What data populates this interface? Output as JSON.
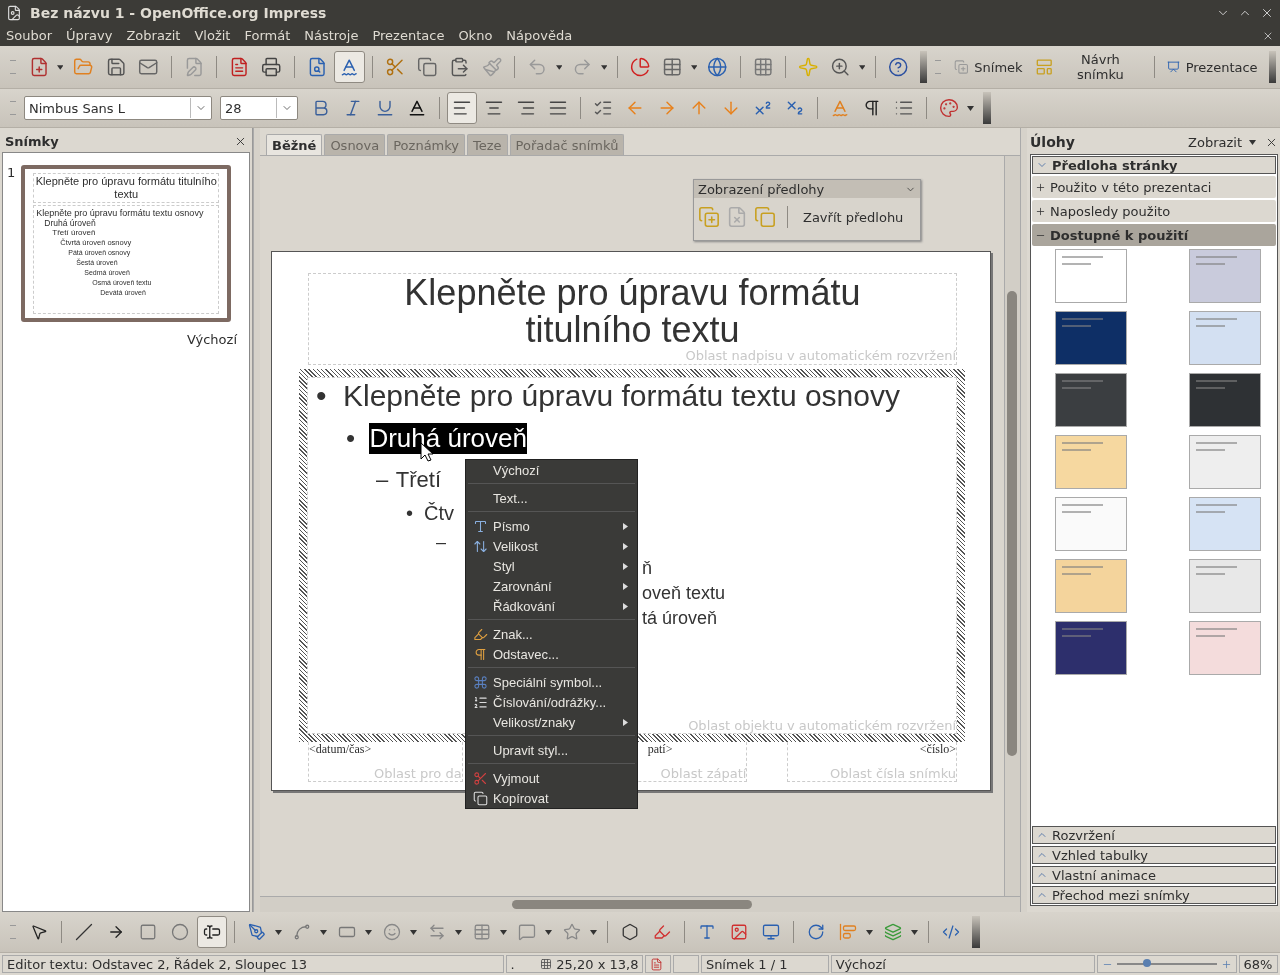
{
  "window": {
    "title": "Bez názvu 1 - OpenOffice.org Impress"
  },
  "menu": [
    "Soubor",
    "Úpravy",
    "Zobrazit",
    "Vložit",
    "Formát",
    "Nástroje",
    "Prezentace",
    "Okno",
    "Nápověda"
  ],
  "standard_toolbar": [
    {
      "pressed": false
    },
    {
      "pressed": false
    },
    {
      "pressed": false
    },
    {
      "pressed": false
    },
    {
      "pressed": false
    },
    {
      "pressed": false
    },
    {
      "pressed": false
    },
    {
      "pressed": false
    },
    {
      "pressed": true
    },
    {
      "pressed": false
    },
    {
      "pressed": false
    },
    {
      "pressed": false
    },
    {
      "pressed": false
    },
    {
      "pressed": false
    },
    {
      "pressed": false
    },
    {
      "pressed": false
    },
    {
      "pressed": false
    },
    {
      "pressed": false
    },
    {
      "pressed": false
    },
    {
      "pressed": false
    },
    {
      "pressed": false
    },
    {
      "pressed": false
    }
  ],
  "presentation_toolbar": [
    {
      "label": "Snímek"
    },
    {
      "label": "Návrh snímku"
    },
    {
      "label": "Prezentace"
    }
  ],
  "formatting_toolbar": {
    "font": "Nimbus Sans L",
    "size": "28",
    "buttons": [
      {
        "pressed": false
      },
      {
        "pressed": false
      },
      {
        "pressed": false
      },
      {
        "pressed": false
      },
      {
        "pressed": true
      },
      {
        "pressed": false
      },
      {
        "pressed": false
      },
      {
        "pressed": false
      },
      {
        "pressed": false
      },
      {
        "pressed": false
      },
      {
        "pressed": false
      },
      {
        "pressed": false
      },
      {
        "pressed": false
      },
      {
        "pressed": false
      },
      {
        "pressed": false
      },
      {
        "pressed": false
      },
      {
        "pressed": false
      },
      {
        "pressed": false
      },
      {
        "pressed": false
      }
    ]
  },
  "slides_panel": {
    "title": "Snímky",
    "slides": [
      {
        "number": "1",
        "layout": "Výchozí",
        "selected": true,
        "title": "Klepněte pro úpravu formátu titulního textu",
        "outline": [
          "Klepněte pro úpravu formátu textu osnovy",
          "Druhá úroveň",
          "Třetí úroveň",
          "Čtvrtá úroveň osnovy",
          "Pátá úroveň osnovy",
          "Šestá úroveň",
          "Sedmá úroveň",
          "Osmá úroveň textu",
          "Devátá úroveň"
        ]
      }
    ]
  },
  "view_tabs": [
    {
      "label": "Běžné",
      "selected": true
    },
    {
      "label": "Osnova",
      "selected": false
    },
    {
      "label": "Poznámky",
      "selected": false
    },
    {
      "label": "Teze",
      "selected": false
    },
    {
      "label": "Pořadač snímků",
      "selected": false
    }
  ],
  "master_view_toolbar": {
    "title": "Zobrazení předlohy",
    "close_label": "Zavřít předlohu"
  },
  "slide": {
    "title": "Klepněte pro úpravu formátu titulního textu",
    "title_area": "Oblast nadpisu v automatickém rozvržení",
    "outline": [
      {
        "marker": "•",
        "text": "Klepněte pro úpravu formátu textu osnovy",
        "children": [
          {
            "marker": "•",
            "text": "Druhá úroveň",
            "highlighted": true,
            "children": [
              {
                "marker": "–",
                "text": "Třetí",
                "children": [
                  {
                    "marker": "•",
                    "text": "Čtv",
                    "children": [
                      {
                        "marker": "–",
                        "children": [
                          {
                            "text": "ň",
                            "children": [
                              {
                                "text": "oveň textu",
                                "children": [
                                  {
                                    "text": "tá úroveň"
                                  }
                                ]
                              }
                            ]
                          }
                        ]
                      }
                    ]
                  }
                ]
              }
            ]
          }
        ]
      }
    ],
    "object_area": "Oblast objektu v automatickém rozvržení",
    "footer": [
      {
        "field": "<datum/čas>",
        "area": "Oblast pro da"
      },
      {
        "field": "patí>",
        "area": "Oblast zápatí"
      },
      {
        "field": "<číslo>",
        "area": "Oblast čísla snímku"
      }
    ]
  },
  "context_menu": [
    {
      "kind": "item",
      "label": "Výchozí",
      "submenu": false
    },
    {
      "kind": "separator"
    },
    {
      "kind": "item",
      "label": "Text...",
      "submenu": false
    },
    {
      "kind": "separator"
    },
    {
      "kind": "item",
      "label": "Písmo",
      "submenu": true
    },
    {
      "kind": "item",
      "label": "Velikost",
      "submenu": true
    },
    {
      "kind": "item",
      "label": "Styl",
      "submenu": true
    },
    {
      "kind": "item",
      "label": "Zarovnání",
      "submenu": true
    },
    {
      "kind": "item",
      "label": "Řádkování",
      "submenu": true
    },
    {
      "kind": "separator"
    },
    {
      "kind": "item",
      "label": "Znak...",
      "submenu": false
    },
    {
      "kind": "item",
      "label": "Odstavec...",
      "submenu": false
    },
    {
      "kind": "separator"
    },
    {
      "kind": "item",
      "label": "Speciální symbol...",
      "submenu": false
    },
    {
      "kind": "item",
      "label": "Číslování/odrážky...",
      "submenu": false
    },
    {
      "kind": "item",
      "label": "Velikost/znaky",
      "submenu": true
    },
    {
      "kind": "separator"
    },
    {
      "kind": "item",
      "label": "Upravit styl...",
      "submenu": false
    },
    {
      "kind": "separator"
    },
    {
      "kind": "item",
      "label": "Vyjmout",
      "submenu": false
    },
    {
      "kind": "item",
      "label": "Kopírovat",
      "submenu": false
    }
  ],
  "tasks_panel": {
    "title": "Úlohy",
    "view_menu": "Zobrazit",
    "sections": [
      {
        "label": "Předloha stránky",
        "expanded": true,
        "children": [
          {
            "label": "Použito v této prezentaci",
            "expanded": false
          },
          {
            "label": "Naposledy použito",
            "expanded": false
          },
          {
            "label": "Dostupné k použití",
            "expanded": true,
            "designs": [
              {
                "color": "#ffffff"
              },
              {
                "color": "#c9cbdc"
              },
              {
                "color": "#0e2f66"
              },
              {
                "color": "#d3e0f2"
              },
              {
                "color": "#3b3e41"
              },
              {
                "color": "#2e3134"
              },
              {
                "color": "#f6d8a0"
              },
              {
                "color": "#eeeeee"
              },
              {
                "color": "#fafafa"
              },
              {
                "color": "#d6e3f4"
              },
              {
                "color": "#f4d49c"
              },
              {
                "color": "#e8e8e8"
              },
              {
                "color": "#2d2f6c"
              },
              {
                "color": "#f4dcdc"
              }
            ]
          }
        ]
      },
      {
        "label": "Rozvržení",
        "expanded": false
      },
      {
        "label": "Vzhled tabulky",
        "expanded": false
      },
      {
        "label": "Vlastní animace",
        "expanded": false
      },
      {
        "label": "Přechod mezi snímky",
        "expanded": false
      }
    ]
  },
  "drawing_toolbar": [
    {
      "pressed": false
    },
    {
      "pressed": false
    },
    {
      "pressed": false
    },
    {
      "pressed": false
    },
    {
      "pressed": false
    },
    {
      "pressed": true
    },
    {
      "pressed": false
    },
    {
      "pressed": false
    },
    {
      "pressed": false
    },
    {
      "pressed": false
    },
    {
      "pressed": false
    },
    {
      "pressed": false
    },
    {
      "pressed": false
    },
    {
      "pressed": false
    },
    {
      "pressed": false
    },
    {
      "pressed": false
    },
    {
      "pressed": false
    },
    {
      "pressed": false
    },
    {
      "pressed": false
    },
    {
      "pressed": false
    },
    {
      "pressed": false
    },
    {
      "pressed": false
    },
    {
      "pressed": false
    }
  ],
  "status_bar": {
    "mode": "Editor textu: Odstavec 2, Řádek 2, Sloupec 13",
    "dot": ".",
    "size": "25,20 x 13,8",
    "slide": "Snímek 1 / 1",
    "layout": "Výchozí",
    "zoom": {
      "level": 0.3
    },
    "zoom_label": "68%"
  }
}
